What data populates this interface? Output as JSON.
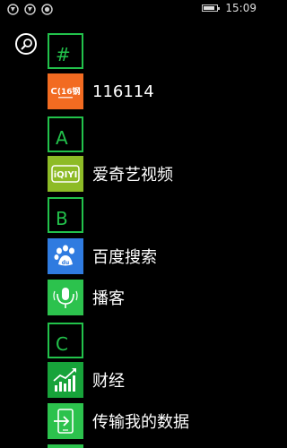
{
  "status_bar": {
    "time": "15:09"
  },
  "search": {
    "icon": "search-icon"
  },
  "groups": [
    {
      "letter": "#"
    },
    {
      "letter": "A"
    },
    {
      "letter": "B"
    },
    {
      "letter": "C"
    }
  ],
  "apps": [
    {
      "name": "116114",
      "tile_color": "#f26b21",
      "icon": "116114-logo",
      "logo_text": "ᑕ(16钢"
    },
    {
      "name": "爱奇艺视频",
      "tile_color": "#8dbb26",
      "icon": "iqiyi-logo",
      "logo_text": "iQIYI"
    },
    {
      "name": "百度搜索",
      "tile_color": "#2f7be0",
      "icon": "baidu-paw-icon"
    },
    {
      "name": "播客",
      "tile_color": "#2cc24d",
      "icon": "podcast-microphone-icon"
    },
    {
      "name": "财经",
      "tile_color": "#17a33a",
      "icon": "finance-chart-icon"
    },
    {
      "name": "传输我的数据",
      "tile_color": "#2cc24d",
      "icon": "phone-transfer-icon"
    }
  ],
  "colors": {
    "accent": "#22c24b",
    "background": "#000000"
  }
}
